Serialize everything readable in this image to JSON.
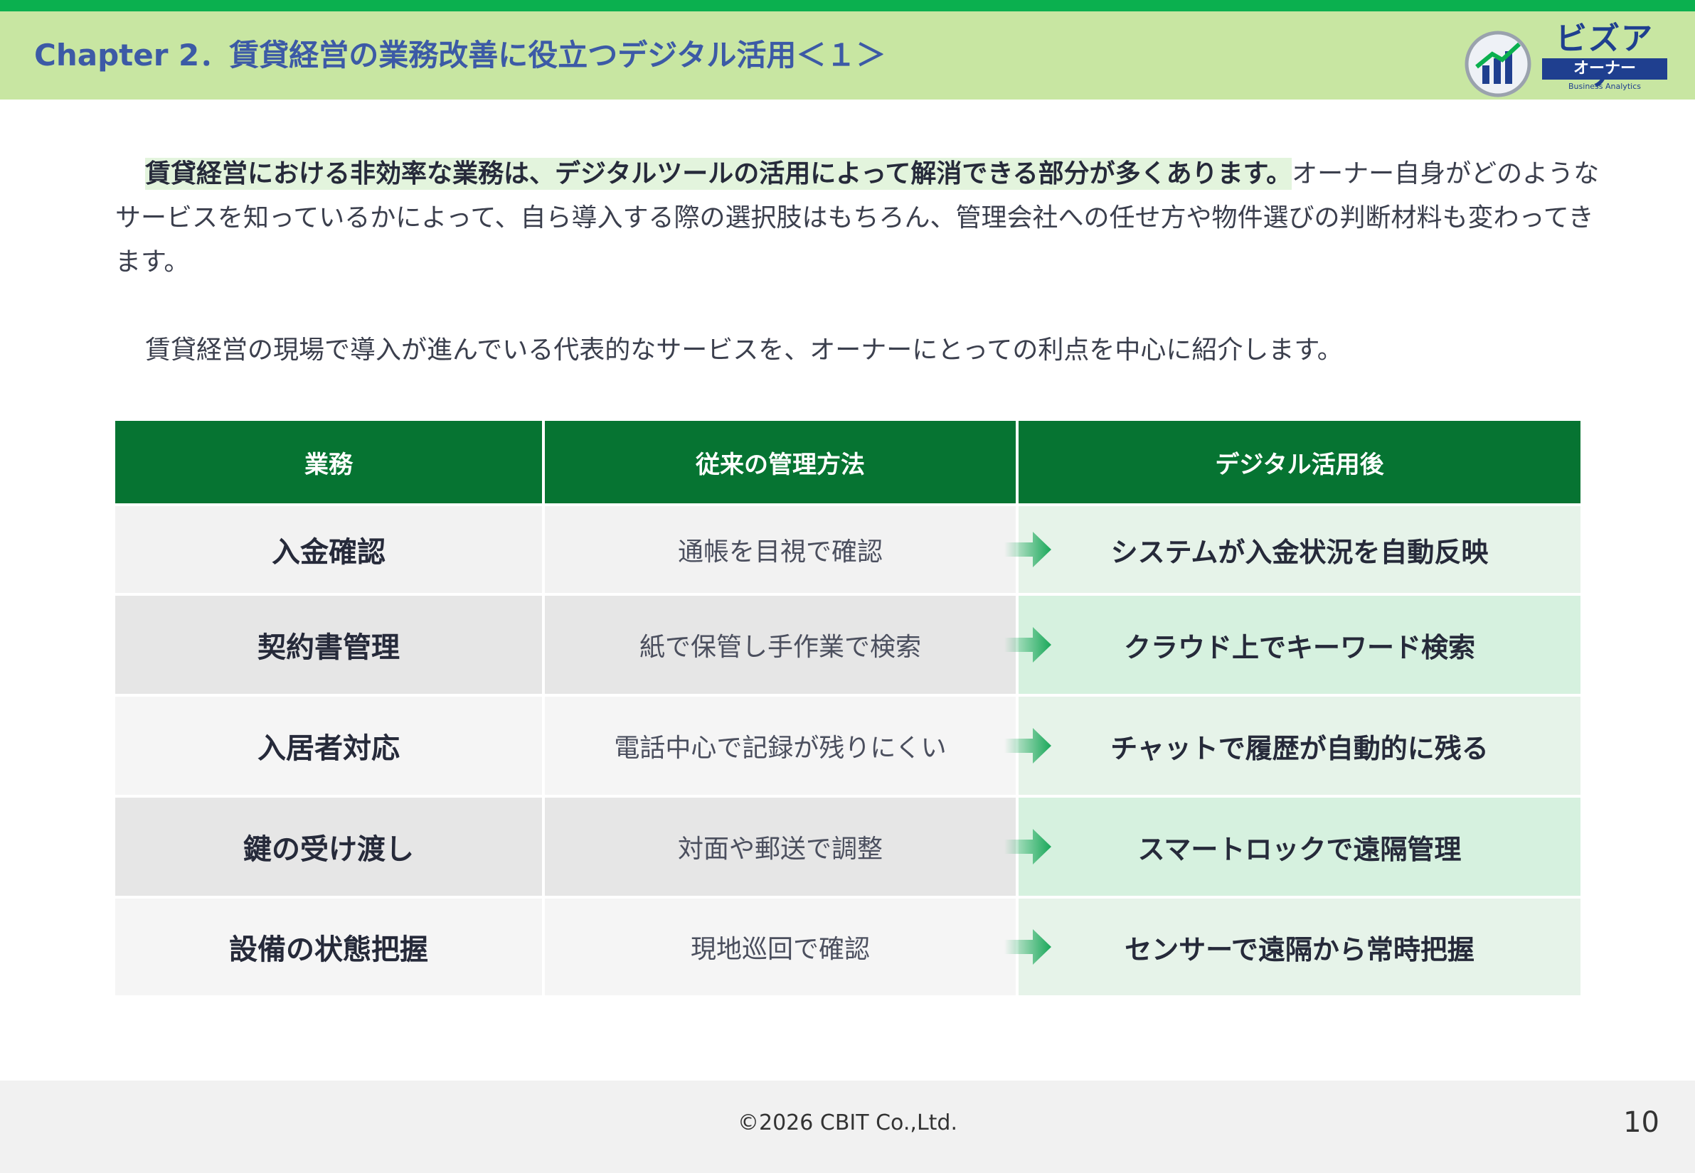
{
  "header": {
    "title": "Chapter 2．賃貸経営の業務改善に役立つデジタル活用＜１＞",
    "logo": {
      "word": "ビズアナ",
      "band": "オーナー",
      "sub": "Business Analytics",
      "icon": "building-chart-logo-icon"
    }
  },
  "body": {
    "p1_highlight": "賃貸経営における非効率な業務は、デジタルツールの活用によって解消できる部分が多くあります。",
    "p1_rest": "オーナー自身がどのようなサービスを知っているかによって、自ら導入する際の選択肢はもちろん、管理会社への任せ方や物件選びの判断材料も変わってきます。",
    "p2": "賃貸経営の現場で導入が進んでいる代表的なサービスを、オーナーにとっての利点を中心に紹介します。"
  },
  "table": {
    "headers": [
      "業務",
      "従来の管理方法",
      "デジタル活用後"
    ],
    "rows": [
      {
        "task": "入金確認",
        "old": "通帳を目視で確認",
        "new": "システムが入金状況を自動反映"
      },
      {
        "task": "契約書管理",
        "old": "紙で保管し手作業で検索",
        "new": "クラウド上でキーワード検索"
      },
      {
        "task": "入居者対応",
        "old": "電話中心で記録が残りにくい",
        "new": "チャットで履歴が自動的に残る"
      },
      {
        "task": "鍵の受け渡し",
        "old": "対面や郵送で調整",
        "new": "スマートロックで遠隔管理"
      },
      {
        "task": "設備の状態把握",
        "old": "現地巡回で確認",
        "new": "センサーで遠隔から常時把握"
      }
    ]
  },
  "footer": {
    "copyright": "©2026 CBIT Co.,Ltd.",
    "page_number": "10"
  },
  "colors": {
    "topline": "#0bb04f",
    "header_bg": "#c8e6a2",
    "title": "#3c5aa6",
    "table_header": "#067432",
    "arrow": "#1aa85a",
    "new_col_light": "#e6f3e9",
    "new_col_dark": "#d6f1df"
  }
}
